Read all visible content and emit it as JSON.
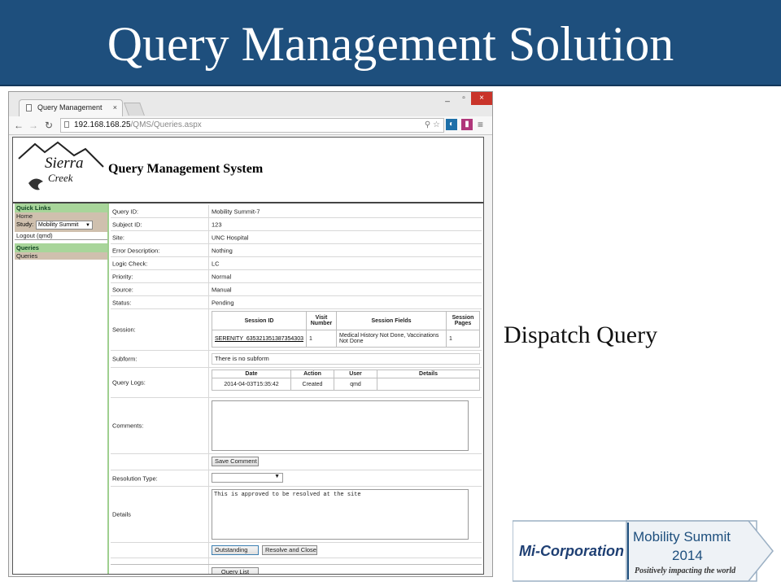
{
  "slide": {
    "title": "Query Management Solution",
    "caption": "Dispatch Query"
  },
  "browser": {
    "tab_title": "Query Management",
    "tab_close": "×",
    "url_host": "192.168.168.25",
    "url_path": "/QMS/Queries.aspx",
    "window_controls": {
      "minimize": "_",
      "maximize": "▫",
      "close": "×"
    }
  },
  "app": {
    "logo_text_1": "Sierra",
    "logo_text_2": "Creek",
    "title": "Query Management System",
    "sidebar": {
      "quick_links_header": "Quick Links",
      "home": "Home",
      "study_label": "Study:",
      "study_value": "Mobility Summit",
      "logout": "Logout (qmd)",
      "queries_header": "Queries",
      "queries_item": "Queries"
    },
    "fields": {
      "query_id_label": "Query ID:",
      "query_id": "Mobility Summit-7",
      "subject_id_label": "Subject ID:",
      "subject_id": "123",
      "site_label": "Site:",
      "site": "UNC Hospital",
      "error_desc_label": "Error Description:",
      "error_desc": "Nothing",
      "logic_check_label": "Logic Check:",
      "logic_check": "LC",
      "priority_label": "Priority:",
      "priority": "Normal",
      "source_label": "Source:",
      "source": "Manual",
      "status_label": "Status:",
      "status": "Pending",
      "session_label": "Session:",
      "subform_label": "Subform:",
      "subform": "There is no subform",
      "query_logs_label": "Query Logs:",
      "comments_label": "Comments:",
      "resolution_type_label": "Resolution Type:",
      "details_label": "Details",
      "details_text": "This is approved to be resolved at the site"
    },
    "session_table": {
      "headers": [
        "Session ID",
        "Visit Number",
        "Session Fields",
        "Session Pages"
      ],
      "row": [
        "SERENITY_635321351387354303",
        "1",
        "Medical History Not Done, Vaccinations Not Done",
        "1"
      ]
    },
    "logs_table": {
      "headers": [
        "Date",
        "Action",
        "User",
        "Details"
      ],
      "row": [
        "2014-04-03T15:35:42",
        "Created",
        "qmd",
        ""
      ]
    },
    "buttons": {
      "save_comment": "Save Comment",
      "outstanding": "Outstanding",
      "resolve_close": "Resolve and Close",
      "query_list": "Query List"
    }
  },
  "sponsor": {
    "company": "Mi-Corporation",
    "event": "Mobility Summit",
    "year": "2014",
    "tagline": "Positively impacting the world"
  },
  "colors": {
    "header_blue": "#1e4f7d",
    "sidebar_green": "#a8d59a",
    "sidebar_tan": "#cfc0ae"
  }
}
